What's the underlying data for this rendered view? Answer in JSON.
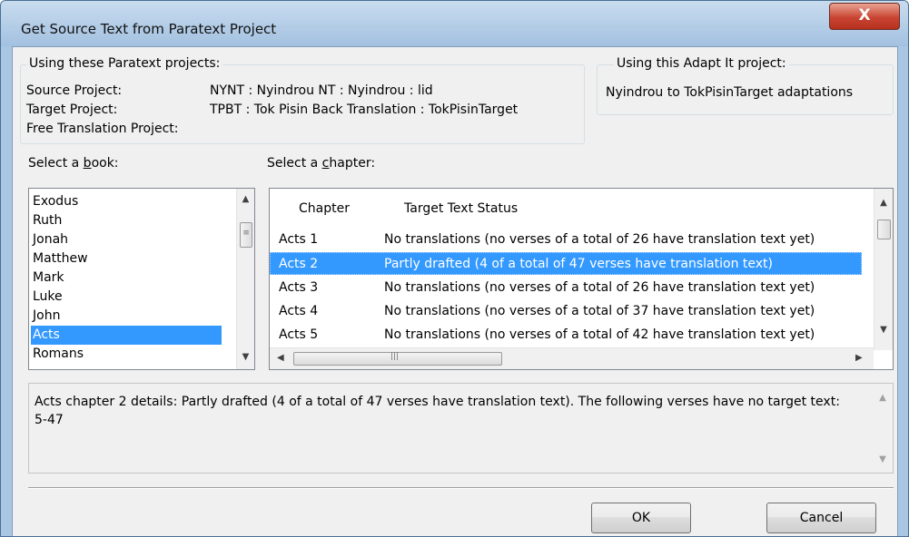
{
  "window": {
    "title": "Get Source Text from Paratext Project",
    "close_label": "X"
  },
  "paratext_group": {
    "label": "Using these Paratext projects:",
    "source_label": "Source Project:",
    "source_value": "NYNT : Nyindrou NT : Nyindrou : lid",
    "target_label": "Target Project:",
    "target_value": "TPBT : Tok Pisin Back Translation : TokPisinTarget",
    "free_label": "Free Translation Project:"
  },
  "adaptit_group": {
    "label": "Using this Adapt It project:",
    "value": "Nyindrou to TokPisinTarget adaptations"
  },
  "book_select": {
    "label_pre": "Select a ",
    "label_key": "b",
    "label_post": "ook:",
    "items": [
      "Exodus",
      "Ruth",
      "Jonah",
      "Matthew",
      "Mark",
      "Luke",
      "John",
      "Acts",
      "Romans"
    ],
    "selected": "Acts"
  },
  "chapter_select": {
    "label_pre": "Select a ",
    "label_key": "c",
    "label_post": "hapter:",
    "columns": [
      "Chapter",
      "Target Text Status"
    ],
    "rows": [
      {
        "chapter": "Acts 1",
        "status": "No translations (no verses of a total of 26 have translation text yet)"
      },
      {
        "chapter": "Acts 2",
        "status": "Partly drafted (4 of a total of 47 verses have translation text)"
      },
      {
        "chapter": "Acts 3",
        "status": "No translations (no verses of a total of 26 have translation text yet)"
      },
      {
        "chapter": "Acts 4",
        "status": "No translations (no verses of a total of 37 have translation text yet)"
      },
      {
        "chapter": "Acts 5",
        "status": "No translations (no verses of a total of 42 have translation text yet)"
      }
    ],
    "selected": "Acts 2"
  },
  "details": {
    "text": "Acts chapter 2 details: Partly drafted (4 of a total of 47 verses have translation text). The following verses have no target text: 5-47"
  },
  "buttons": {
    "ok": "OK",
    "cancel": "Cancel"
  },
  "colors": {
    "selection": "#3399ff",
    "titlebar": "#a9c6e3",
    "close_button": "#c94532",
    "dialog_bg": "#f0f0f0"
  },
  "icons": [
    "close-icon",
    "scroll-up-arrow-icon",
    "scroll-down-arrow-icon",
    "scroll-left-arrow-icon",
    "scroll-right-arrow-icon",
    "grip-icon"
  ]
}
